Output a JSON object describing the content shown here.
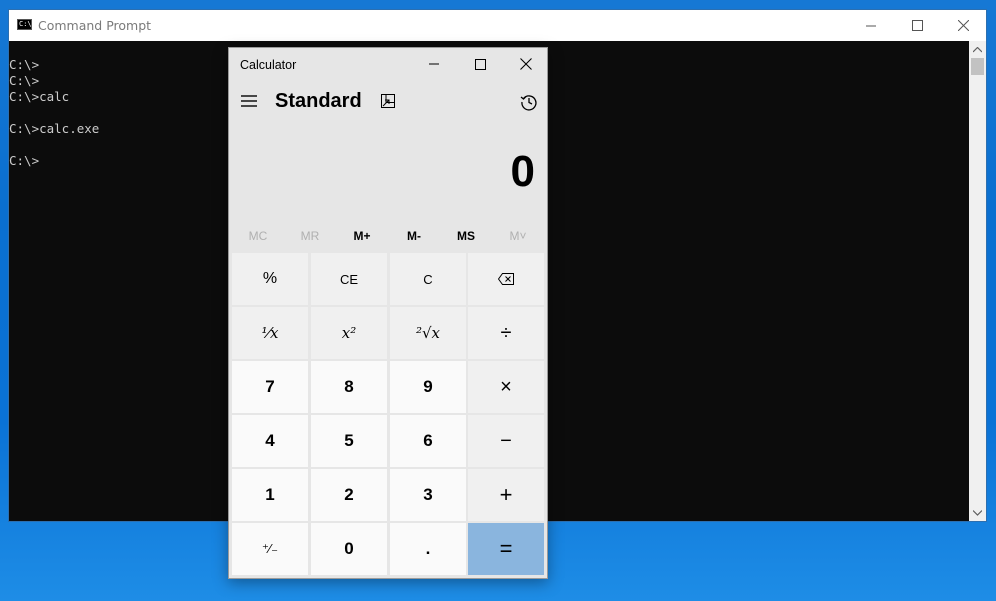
{
  "cmd": {
    "title": "Command Prompt",
    "lines": [
      "C:\\>",
      "C:\\>",
      "C:\\>calc",
      "",
      "C:\\>calc.exe",
      "",
      "C:\\>"
    ]
  },
  "calculator": {
    "title": "Calculator",
    "mode": "Standard",
    "display_value": "0",
    "memory": [
      "MC",
      "MR",
      "M+",
      "M-",
      "MS",
      "M˅"
    ],
    "memory_disabled": [
      true,
      true,
      false,
      false,
      false,
      true
    ],
    "keys": {
      "percent": "%",
      "ce": "CE",
      "c": "C",
      "reciprocal": "¹⁄x",
      "square": "x²",
      "sqrt": "²√x",
      "divide": "÷",
      "seven": "7",
      "eight": "8",
      "nine": "9",
      "multiply": "×",
      "four": "4",
      "five": "5",
      "six": "6",
      "minus": "−",
      "one": "1",
      "two": "2",
      "three": "3",
      "plus": "+",
      "negate": "⁺∕₋",
      "zero": "0",
      "decimal": ".",
      "equals": "="
    },
    "colors": {
      "equals_bg": "#8ab5de",
      "window_bg": "#e6e6e6"
    }
  }
}
